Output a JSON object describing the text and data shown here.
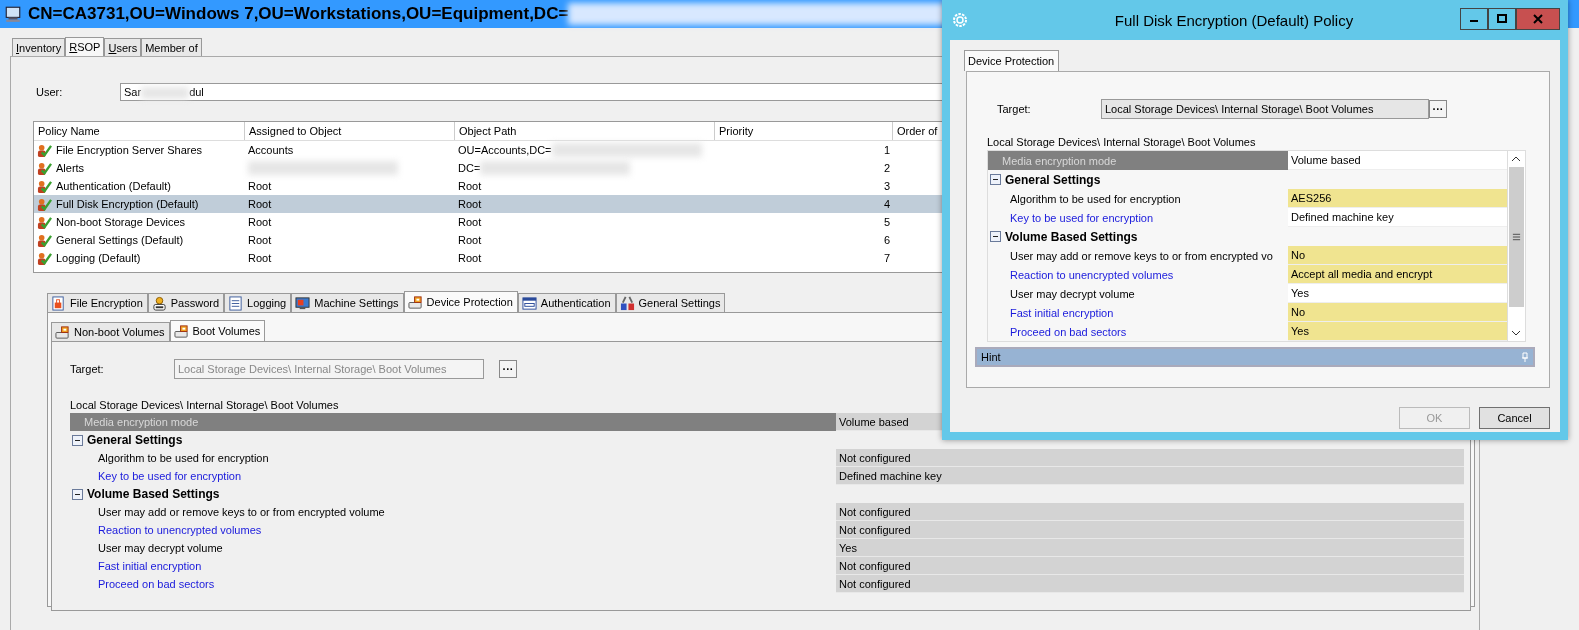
{
  "window": {
    "title": "CN=CA3731,OU=Windows 7,OU=Workstations,OU=Equipment,DC=",
    "title_redacted": true
  },
  "tabs": [
    {
      "label": "Inventory",
      "selected": false,
      "mnemonic": true
    },
    {
      "label": "RSOP",
      "selected": true,
      "mnemonic": true
    },
    {
      "label": "Users",
      "selected": false,
      "mnemonic": true
    },
    {
      "label": "Member of",
      "selected": false,
      "mnemonic": false
    }
  ],
  "user": {
    "label": "User:",
    "value_start": "Sar",
    "value_end": "dul",
    "redacted": true
  },
  "policies": {
    "columns": [
      "Policy Name",
      "Assigned to Object",
      "Object Path",
      "Priority",
      "Order of"
    ],
    "rows": [
      {
        "name": "File Encryption Server Shares",
        "assigned": "Accounts",
        "path": "OU=Accounts,DC=",
        "priority": "1",
        "selected": false,
        "assigned_redacted": false,
        "path_redacted": true
      },
      {
        "name": "Alerts",
        "path": "DC=",
        "priority": "2",
        "selected": false,
        "assigned_redacted": true,
        "path_redacted": true
      },
      {
        "name": "Authentication (Default)",
        "assigned": "Root",
        "path": "Root",
        "priority": "3",
        "selected": false,
        "assigned_redacted": false,
        "path_redacted": false
      },
      {
        "name": "Full Disk Encryption (Default)",
        "assigned": "Root",
        "path": "Root",
        "priority": "4",
        "selected": true,
        "assigned_redacted": false,
        "path_redacted": false
      },
      {
        "name": "Non-boot Storage Devices",
        "assigned": "Root",
        "path": "Root",
        "priority": "5",
        "selected": false,
        "assigned_redacted": false,
        "path_redacted": false
      },
      {
        "name": "General Settings (Default)",
        "assigned": "Root",
        "path": "Root",
        "priority": "6",
        "selected": false,
        "assigned_redacted": false,
        "path_redacted": false
      },
      {
        "name": "Logging (Default)",
        "assigned": "Root",
        "path": "Root",
        "priority": "7",
        "selected": false,
        "assigned_redacted": false,
        "path_redacted": false
      }
    ]
  },
  "policy_tabs": [
    {
      "label": "File Encryption",
      "kind": "file",
      "selected": false
    },
    {
      "label": "Password",
      "kind": "user",
      "selected": false
    },
    {
      "label": "Logging",
      "kind": "document",
      "selected": false
    },
    {
      "label": "Machine Settings",
      "kind": "machine",
      "selected": false
    },
    {
      "label": "Device Protection",
      "kind": "device",
      "selected": true
    },
    {
      "label": "Authentication",
      "kind": "window",
      "selected": false
    },
    {
      "label": "General Settings",
      "kind": "tools",
      "selected": false
    }
  ],
  "volume_tabs": [
    {
      "label": "Non-boot Volumes",
      "selected": false
    },
    {
      "label": "Boot Volumes",
      "selected": true
    }
  ],
  "target": {
    "label": "Target:",
    "value": "Local Storage Devices\\ Internal Storage\\ Boot Volumes",
    "browse": "···",
    "disabled": true
  },
  "group_label": "Local Storage Devices\\ Internal Storage\\ Boot Volumes",
  "settings": {
    "read_only": true,
    "items": [
      {
        "kind": "header",
        "label": "Media encryption mode",
        "value": "Volume based"
      },
      {
        "kind": "category",
        "label": "General Settings",
        "expanded": true
      },
      {
        "kind": "item",
        "label": "Algorithm to be used for encryption",
        "value": "Not configured",
        "defined": false,
        "highlighted": false
      },
      {
        "kind": "item",
        "label": "Key to be used for encryption",
        "value": "Defined machine key",
        "defined": true,
        "highlighted": false
      },
      {
        "kind": "category",
        "label": "Volume Based Settings",
        "expanded": true
      },
      {
        "kind": "item",
        "label": "User may add or remove keys to or from encrypted volume",
        "value": "Not configured",
        "defined": false,
        "highlighted": false
      },
      {
        "kind": "item",
        "label": "Reaction to unencrypted volumes",
        "value": "Not configured",
        "defined": true,
        "highlighted": false
      },
      {
        "kind": "item",
        "label": "User may decrypt volume",
        "value": "Yes",
        "defined": false,
        "highlighted": false
      },
      {
        "kind": "item",
        "label": "Fast initial encryption",
        "value": "Not configured",
        "defined": true,
        "highlighted": false
      },
      {
        "kind": "item",
        "label": "Proceed on bad sectors",
        "value": "Not configured",
        "defined": true,
        "highlighted": false
      }
    ]
  },
  "dialog": {
    "title": "Full Disk Encryption (Default) Policy",
    "tabs": [
      {
        "label": "Device Protection",
        "selected": true
      }
    ],
    "target": {
      "label": "Target:",
      "value": "Local Storage Devices\\ Internal Storage\\ Boot Volumes",
      "browse": "···",
      "disabled": false
    },
    "group_label": "Local Storage Devices\\ Internal Storage\\ Boot Volumes",
    "settings": {
      "read_only": false,
      "items": [
        {
          "kind": "header",
          "label": "Media encryption mode",
          "value": "Volume based"
        },
        {
          "kind": "category",
          "label": "General Settings",
          "expanded": true
        },
        {
          "kind": "item",
          "label": "Algorithm to be used for encryption",
          "value": "AES256",
          "defined": false,
          "highlighted": true
        },
        {
          "kind": "item",
          "label": "Key to be used for encryption",
          "value": "Defined machine key",
          "defined": true,
          "highlighted": false
        },
        {
          "kind": "category",
          "label": "Volume Based Settings",
          "expanded": true
        },
        {
          "kind": "item",
          "label": "User may add or remove keys to or from encrypted vo",
          "value": "No",
          "defined": false,
          "highlighted": true
        },
        {
          "kind": "item",
          "label": "Reaction to unencrypted volumes",
          "value": "Accept all media and encrypt",
          "defined": true,
          "highlighted": true
        },
        {
          "kind": "item",
          "label": "User may decrypt volume",
          "value": "Yes",
          "defined": false,
          "highlighted": false
        },
        {
          "kind": "item",
          "label": "Fast initial encryption",
          "value": "No",
          "defined": true,
          "highlighted": true
        },
        {
          "kind": "item",
          "label": "Proceed on bad sectors",
          "value": "Yes",
          "defined": true,
          "highlighted": true
        }
      ]
    },
    "hint": "Hint",
    "buttons": [
      {
        "label": "OK",
        "disabled": true
      },
      {
        "label": "Cancel",
        "disabled": false
      }
    ]
  }
}
